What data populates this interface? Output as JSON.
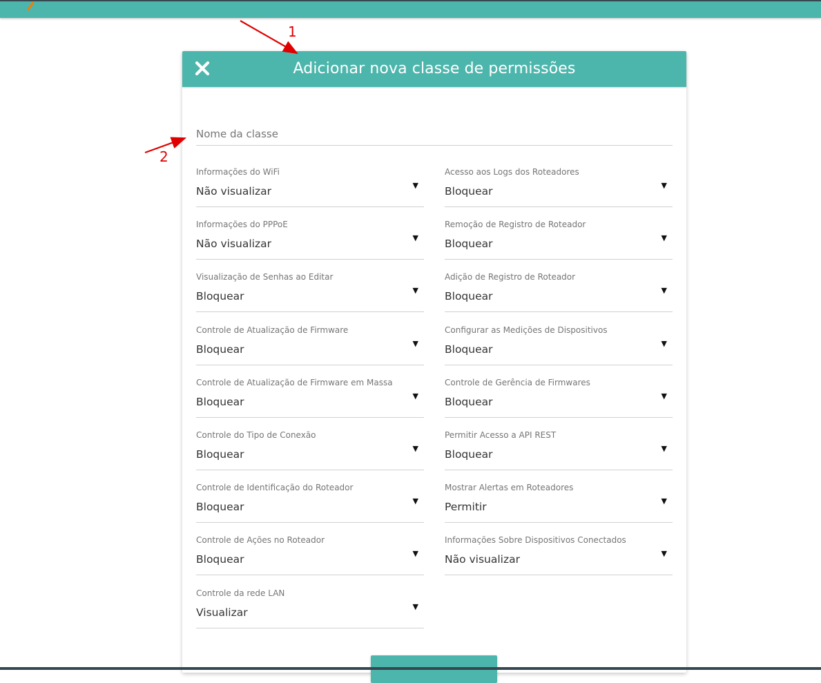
{
  "modal": {
    "title": "Adicionar nova classe de permissões",
    "close_icon": "close-icon",
    "name_field": {
      "placeholder": "Nome da classe",
      "value": ""
    },
    "save_label": ""
  },
  "permissions_left": [
    {
      "label": "Informações do WiFi",
      "value": "Não visualizar"
    },
    {
      "label": "Informações do PPPoE",
      "value": "Não visualizar"
    },
    {
      "label": "Visualização de Senhas ao Editar",
      "value": "Bloquear"
    },
    {
      "label": "Controle de Atualização de Firmware",
      "value": "Bloquear"
    },
    {
      "label": "Controle de Atualização de Firmware em Massa",
      "value": "Bloquear"
    },
    {
      "label": "Controle do Tipo de Conexão",
      "value": "Bloquear"
    },
    {
      "label": "Controle de Identificação do Roteador",
      "value": "Bloquear"
    },
    {
      "label": "Controle de Ações no Roteador",
      "value": "Bloquear"
    },
    {
      "label": "Controle da rede LAN",
      "value": "Visualizar"
    }
  ],
  "permissions_right": [
    {
      "label": "Acesso aos Logs dos Roteadores",
      "value": "Bloquear"
    },
    {
      "label": "Remoção de Registro de Roteador",
      "value": "Bloquear"
    },
    {
      "label": "Adição de Registro de Roteador",
      "value": "Bloquear"
    },
    {
      "label": "Configurar as Medições de Dispositivos",
      "value": "Bloquear"
    },
    {
      "label": "Controle de Gerência de Firmwares",
      "value": "Bloquear"
    },
    {
      "label": "Permitir Acesso a API REST",
      "value": "Bloquear"
    },
    {
      "label": "Mostrar Alertas em Roteadores",
      "value": "Permitir"
    },
    {
      "label": "Informações Sobre Dispositivos Conectados",
      "value": "Não visualizar"
    }
  ],
  "dropdown_arrow": "▼",
  "annotations": {
    "one": "1",
    "two": "2",
    "color": "#e00000"
  },
  "colors": {
    "accent": "#4db6ac",
    "dark": "#37474f"
  }
}
